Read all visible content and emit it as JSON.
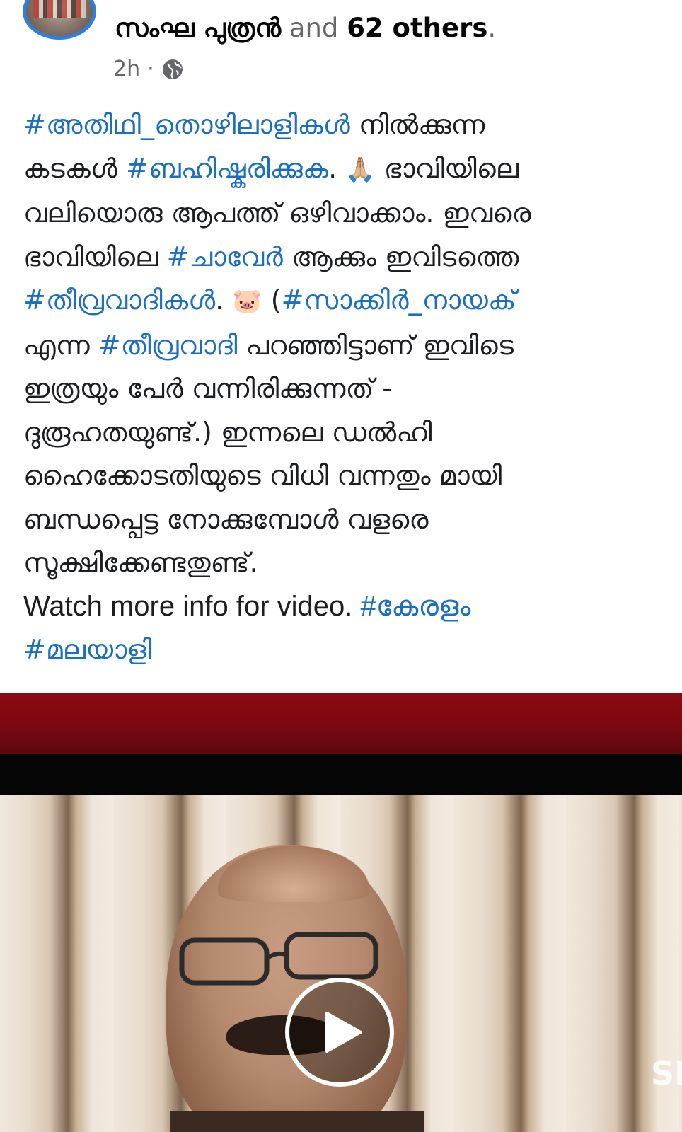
{
  "post": {
    "author_name": "സംഘ പുത്രൻ",
    "author_and": "and",
    "author_others": "62 others",
    "author_dot": ".",
    "time": "2h",
    "time_sep": "·",
    "privacy_icon": "globe-icon"
  },
  "text": {
    "l1_tag": "#അതിഥി_തൊഴിലാളികൾ",
    "l1_rest": " നിൽക്കുന്ന",
    "l2_a": "കടകൾ ",
    "l2_tag": "#ബഹിഷ്കരിക്കുക",
    "l2_b": ". ",
    "l2_emoji": "🙏🏼",
    "l2_c": " ഭാവിയിലെ",
    "l3": "വലിയൊരു ആപത്ത് ഒഴിവാക്കാം. ഇവരെ",
    "l4_a": "ഭാവിയിലെ ",
    "l4_tag": "#ചാവേർ",
    "l4_b": " ആക്കും ഇവിടത്തെ",
    "l5_tag": "#തീവ്രവാദികൾ",
    "l5_a": ". ",
    "l5_emoji": "🐷",
    "l5_b": " (",
    "l5_tag2": "#സാക്കിർ_നായക്",
    "l6_a": "എന്ന ",
    "l6_tag": "#തീവ്രവാദി",
    "l6_b": " പറഞ്ഞിട്ടാണ് ഇവിടെ",
    "l7": "ഇത്രയും പേർ  വന്നിരിക്കുന്നത് -",
    "l8": "ദുരൂഹതയുണ്ട്.) ഇന്നലെ ഡൽഹി",
    "l9": "ഹൈക്കോടതിയുടെ വിധി വന്നതും മായി",
    "l10": "ബന്ധപ്പെട്ട നോക്കുമ്പോൾ വളരെ",
    "l11": "സൂക്ഷിക്കേണ്ടതുണ്ട്.",
    "l12_a": "Watch more info for video. ",
    "l12_tag": "#കേരളം",
    "l13_tag": "#മലയാളി"
  },
  "video": {
    "watermark": "SH",
    "play_icon": "play-icon"
  },
  "colors": {
    "hashtag": "#1b6fc2",
    "meta": "#65676b",
    "banner_red": "#8c0a13",
    "avatar_ring": "#2f7fe0"
  }
}
